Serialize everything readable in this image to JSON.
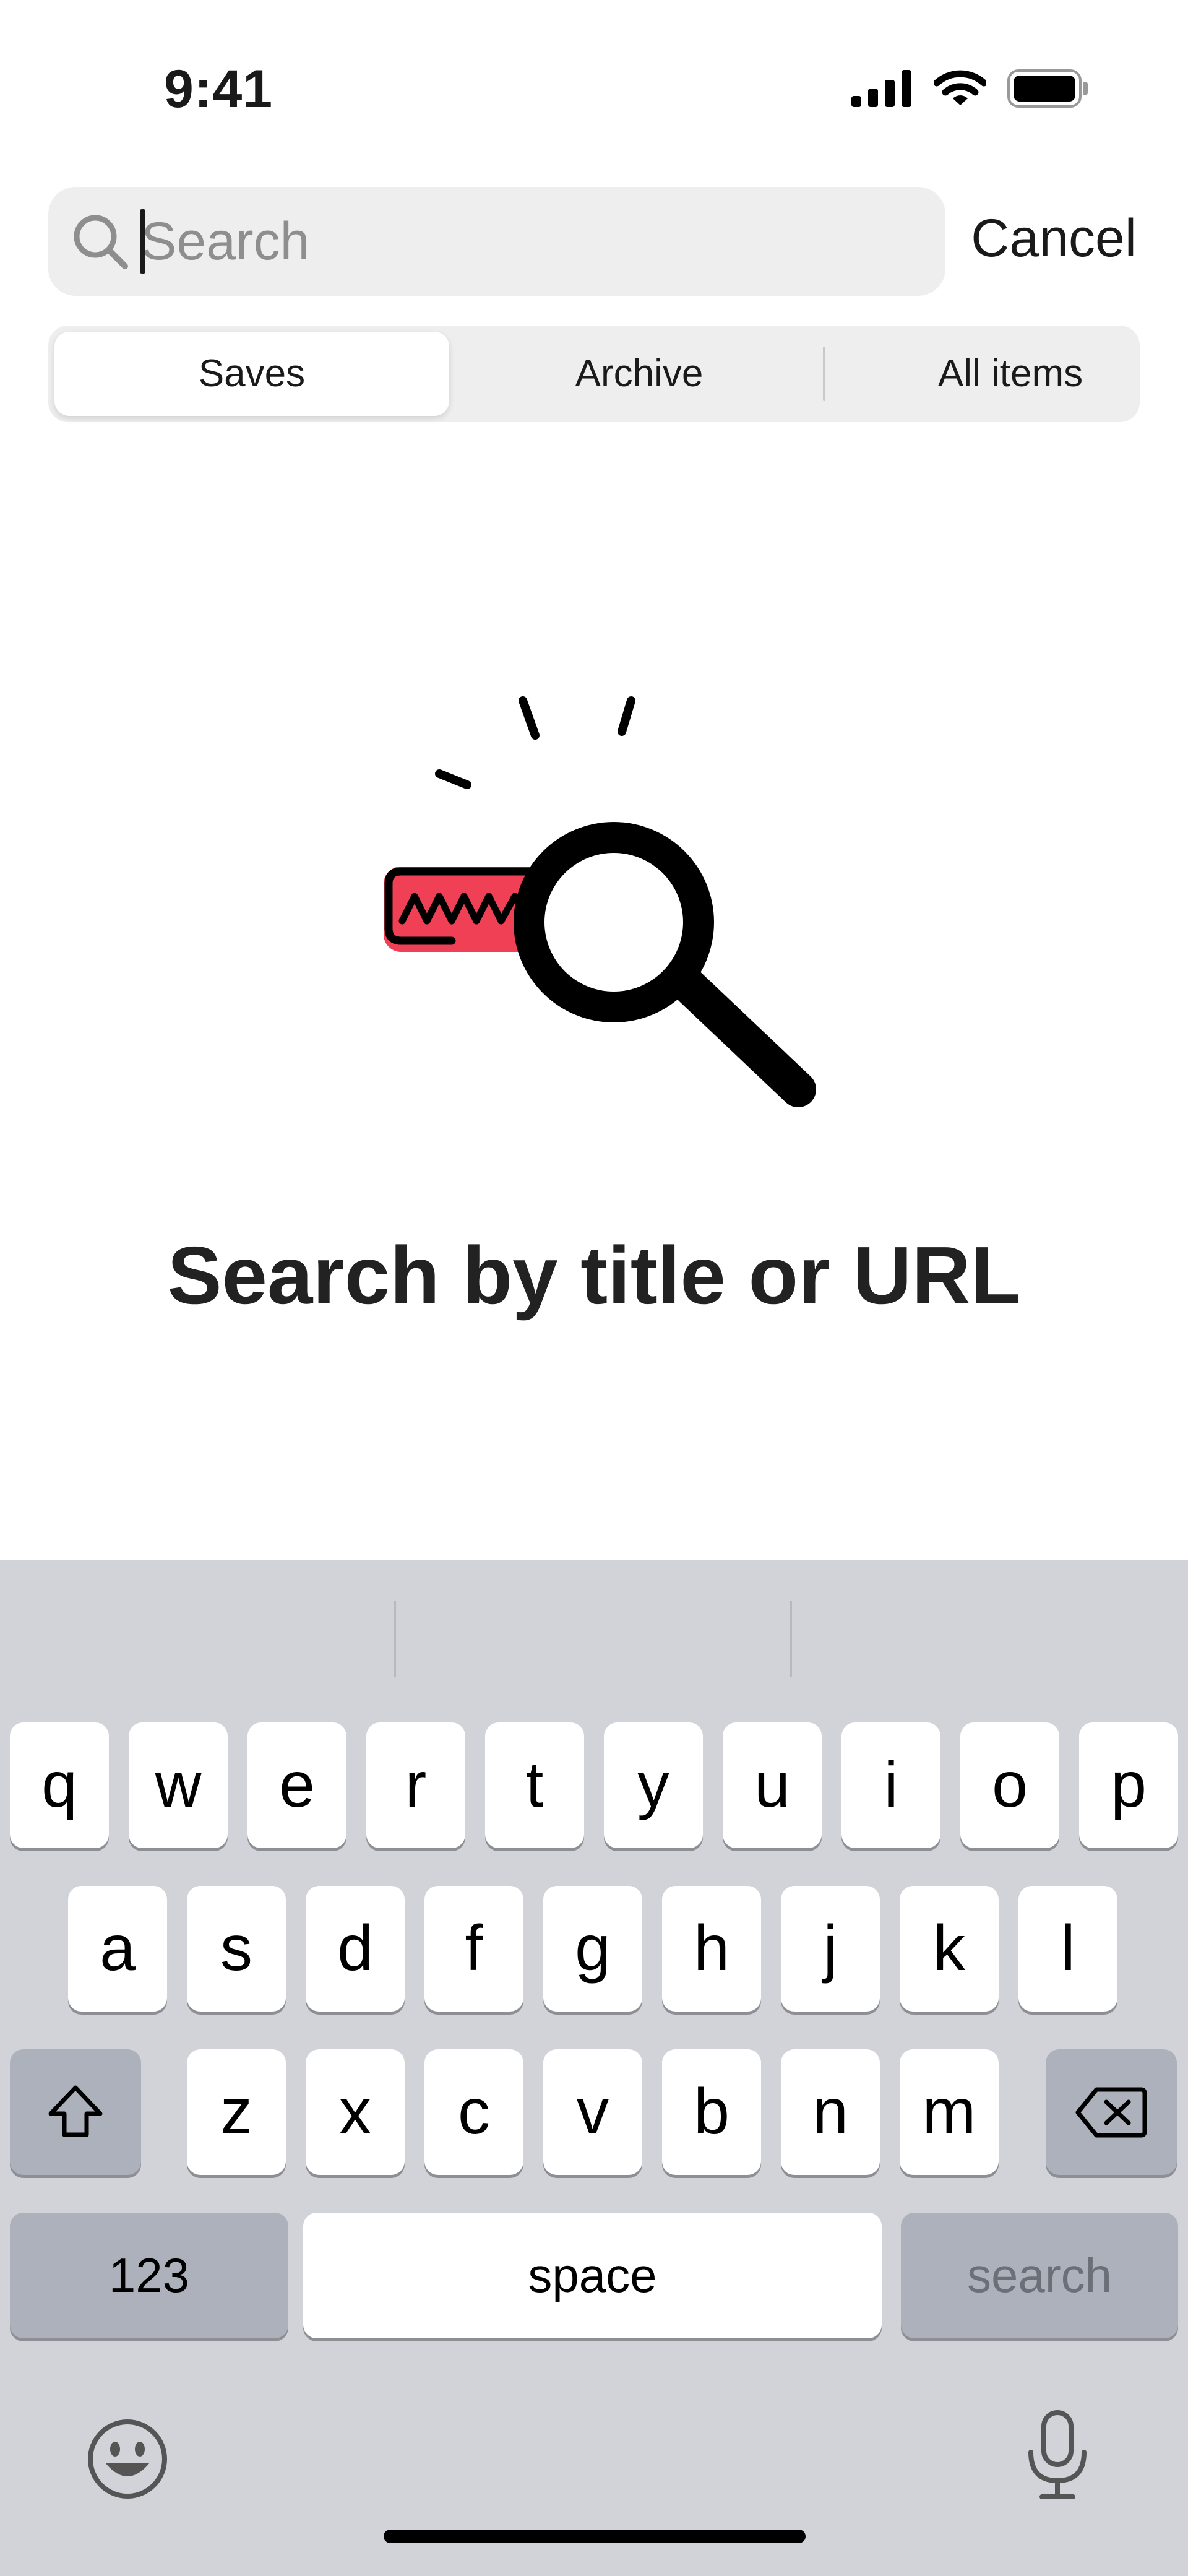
{
  "status_bar": {
    "time": "9:41",
    "icons": [
      "signal-icon",
      "wifi-icon",
      "battery-icon"
    ]
  },
  "search": {
    "value": "",
    "placeholder": "Search",
    "cancel_label": "Cancel"
  },
  "filter_tabs": [
    {
      "label": "Saves",
      "selected": true
    },
    {
      "label": "Archive",
      "selected": false
    },
    {
      "label": "All items",
      "selected": false
    }
  ],
  "empty_state": {
    "title": "Search by title or URL",
    "illustration": "magnifying-glass-illustration",
    "accent_color": "#ef4056"
  },
  "keyboard": {
    "row1": [
      "q",
      "w",
      "e",
      "r",
      "t",
      "y",
      "u",
      "i",
      "o",
      "p"
    ],
    "row2": [
      "a",
      "s",
      "d",
      "f",
      "g",
      "h",
      "j",
      "k",
      "l"
    ],
    "row3": [
      "z",
      "x",
      "c",
      "v",
      "b",
      "n",
      "m"
    ],
    "numbers_label": "123",
    "space_label": "space",
    "action_label": "search",
    "shift_icon": "shift-icon",
    "delete_icon": "delete-icon",
    "emoji_icon": "emoji-icon",
    "mic_icon": "microphone-icon"
  }
}
